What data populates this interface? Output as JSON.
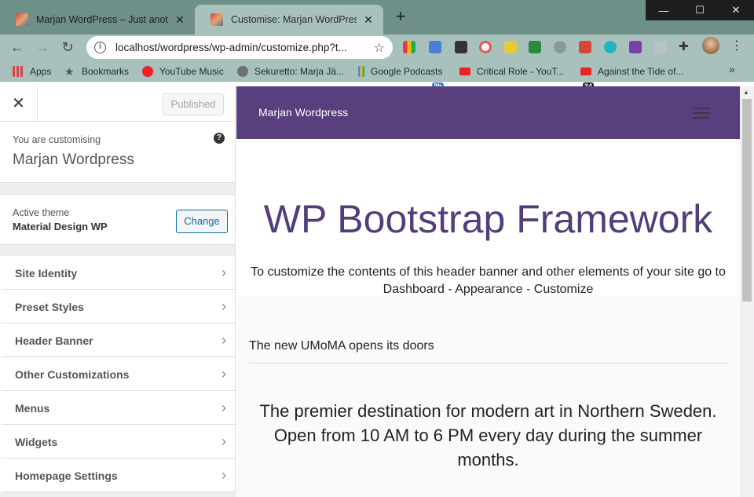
{
  "browser": {
    "tabs": [
      {
        "title": "Marjan WordPress – Just another",
        "close": "✕"
      },
      {
        "title": "Customise: Marjan WordPress – J",
        "close": "✕"
      }
    ],
    "new_tab": "+",
    "window_controls": {
      "minimize": "—",
      "maximize": "☐",
      "close": "✕"
    },
    "address": "localhost/wordpress/wp-admin/customize.php?t...",
    "bookmarks": [
      {
        "label": "Apps",
        "icon": "apps-grid-icon"
      },
      {
        "label": "Bookmarks",
        "icon": "star-icon"
      },
      {
        "label": "YouTube Music",
        "icon": "youtube-music-icon"
      },
      {
        "label": "Sekuretto: Marja Jä...",
        "icon": "globe-icon"
      },
      {
        "label": "Google Podcasts",
        "icon": "google-podcasts-icon"
      },
      {
        "label": "Critical Role - YouT...",
        "icon": "youtube-icon"
      },
      {
        "label": "Against the Tide of...",
        "icon": "youtube-icon"
      }
    ],
    "extension_badges": {
      "calendar": "2h",
      "todoist": "34"
    },
    "more_bookmarks": "»"
  },
  "customizer": {
    "close": "✕",
    "publish_label": "Published",
    "customising_label": "You are customising",
    "site_name": "Marjan Wordpress",
    "help": "?",
    "theme": {
      "label": "Active theme",
      "name": "Material Design WP",
      "change_label": "Change"
    },
    "menu": [
      "Site Identity",
      "Preset Styles",
      "Header Banner",
      "Other Customizations",
      "Menus",
      "Widgets",
      "Homepage Settings"
    ],
    "chevron": "›"
  },
  "preview": {
    "brand": "Marjan Wordpress",
    "title": "WP Bootstrap Framework",
    "subtitle": "To customize the contents of this header banner and other elements of your site go to Dashboard - Appearance - Customize",
    "news_heading": "The new UMoMA opens its doors",
    "description": "The premier destination for modern art in Northern Sweden. Open from 10 AM to 6 PM every day during the summer months."
  },
  "colors": {
    "nav_purple": "#593f7e",
    "title_purple": "#533d7a",
    "wp_blue": "#0071a1",
    "chrome_frame": "#6f9089",
    "chrome_toolbar": "#a9c1bc"
  }
}
